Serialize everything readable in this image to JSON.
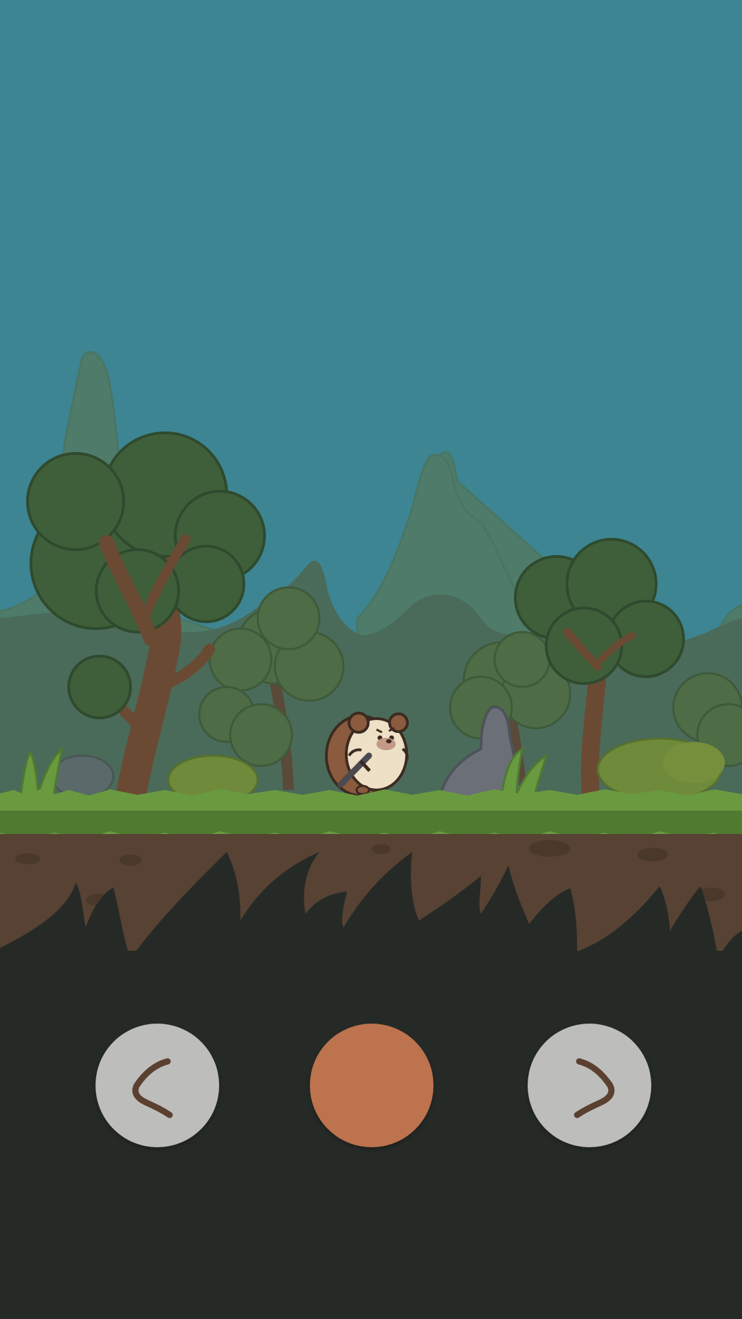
{
  "scene": {
    "sky_color": "#3d8592",
    "far_mountain_color": "#4f7c6a",
    "mid_mountain_color": "#4a6b5a",
    "tree_foliage_color": "#3f5f3a",
    "tree_trunk_color": "#6a4a33",
    "grass_color": "#6a9a40",
    "dirt_color": "#574233",
    "underground_color": "#262a26",
    "rock_color": "#6b6f78",
    "bush_color": "#6e8a3a"
  },
  "character": {
    "name": "hedgehog-swordsman",
    "body_color": "#ede0c6",
    "ear_color": "#8a5b3e",
    "weapon": "sword-icon"
  },
  "controls": {
    "left": {
      "icon": "chevron-left-icon",
      "color": "#bdbebb",
      "glyph_color": "#5b4030"
    },
    "action": {
      "icon": "circle-icon",
      "color": "#bd734d"
    },
    "right": {
      "icon": "chevron-right-icon",
      "color": "#bdbebb",
      "glyph_color": "#5b4030"
    }
  }
}
